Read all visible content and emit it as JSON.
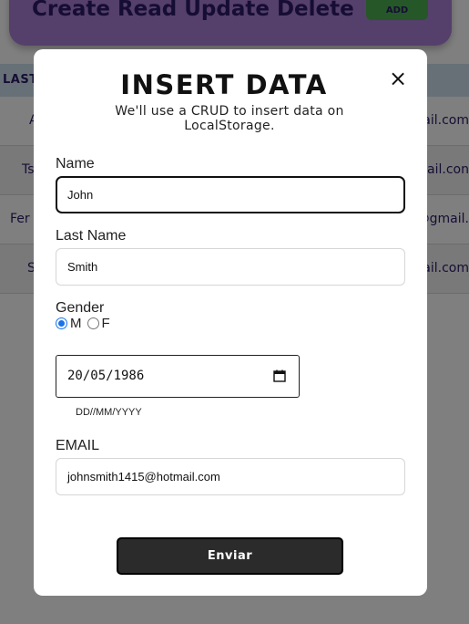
{
  "background": {
    "header_title": "Create Read Update Delete",
    "add_button": "ADD",
    "table_header": "LAST",
    "rows": [
      {
        "c1": "A",
        "c2": "ail.com"
      },
      {
        "c1": "Ts",
        "c2": "mail.con"
      },
      {
        "c1": "Fer",
        "c2": "@gmail."
      },
      {
        "c1": "S",
        "c2": "mail.com"
      }
    ]
  },
  "modal": {
    "title": "INSERT DATA",
    "close": "×",
    "subtitle": "We'll use a CRUD to insert data on LocalStorage.",
    "name_label": "Name",
    "name_value": "John",
    "lastname_label": "Last Name",
    "lastname_value": "Smith",
    "gender_label": "Gender",
    "gender_options": [
      "M",
      "F"
    ],
    "gender_selected": "M",
    "date_value": "20/05/1986",
    "date_hint": "DD//MM/YYYY",
    "email_label": "EMAIL",
    "email_value": "johnsmith1415@hotmail.com",
    "submit_label": "Enviar"
  }
}
